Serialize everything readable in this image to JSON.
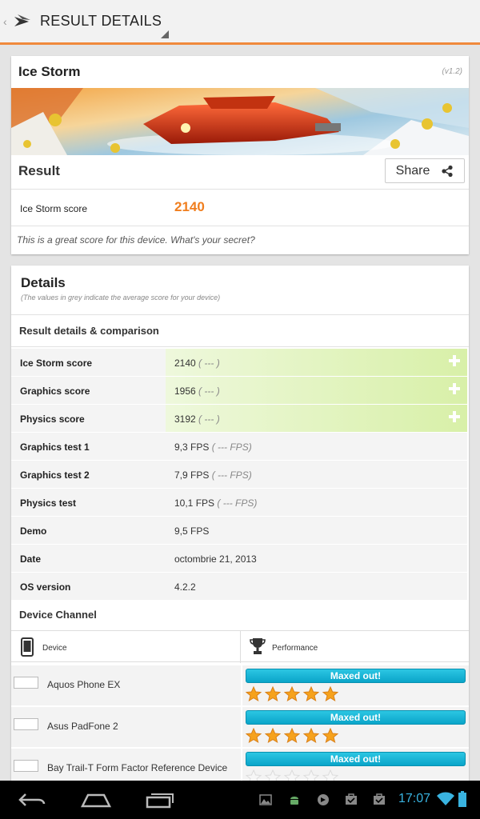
{
  "action_bar": {
    "title": "RESULT DETAILS"
  },
  "result_card": {
    "title": "Ice Storm",
    "version": "(v1.2)",
    "result_label": "Result",
    "share_label": "Share",
    "score_label": "Ice Storm score",
    "score_value": "2140",
    "message": "This is a great score for this device. What's your secret?"
  },
  "details": {
    "title": "Details",
    "subtitle": "(The values in grey indicate the average score for your device)",
    "comparison_title": "Result details & comparison",
    "rows": [
      {
        "label": "Ice Storm score",
        "value": "2140",
        "avg": "( --- )",
        "highlight": true
      },
      {
        "label": "Graphics score",
        "value": "1956",
        "avg": "( --- )",
        "highlight": true
      },
      {
        "label": "Physics score",
        "value": "3192",
        "avg": "( --- )",
        "highlight": true
      },
      {
        "label": "Graphics test 1",
        "value": "9,3 FPS",
        "avg": "( --- FPS)",
        "highlight": false
      },
      {
        "label": "Graphics test 2",
        "value": "7,9 FPS",
        "avg": "( --- FPS)",
        "highlight": false
      },
      {
        "label": "Physics test",
        "value": "10,1 FPS",
        "avg": "( --- FPS)",
        "highlight": false
      },
      {
        "label": "Demo",
        "value": "9,5 FPS",
        "avg": "",
        "highlight": false
      },
      {
        "label": "Date",
        "value": "octombrie 21, 2013",
        "avg": "",
        "highlight": false
      },
      {
        "label": "OS version",
        "value": "4.2.2",
        "avg": "",
        "highlight": false
      }
    ],
    "channel_title": "Device Channel",
    "channel_header": {
      "device": "Device",
      "performance": "Performance"
    },
    "devices": [
      {
        "name": "Aquos Phone EX",
        "status": "Maxed out!",
        "stars": 5
      },
      {
        "name": "Asus PadFone 2",
        "status": "Maxed out!",
        "stars": 5
      },
      {
        "name": "Bay Trail-T Form Factor Reference Device",
        "status": "Maxed out!",
        "stars": 0
      }
    ]
  },
  "status_bar": {
    "time": "17:07"
  },
  "colors": {
    "accent": "#f08a3c",
    "score": "#f07e1e",
    "maxed": "#1bb5d6",
    "clock": "#39b3e0"
  }
}
